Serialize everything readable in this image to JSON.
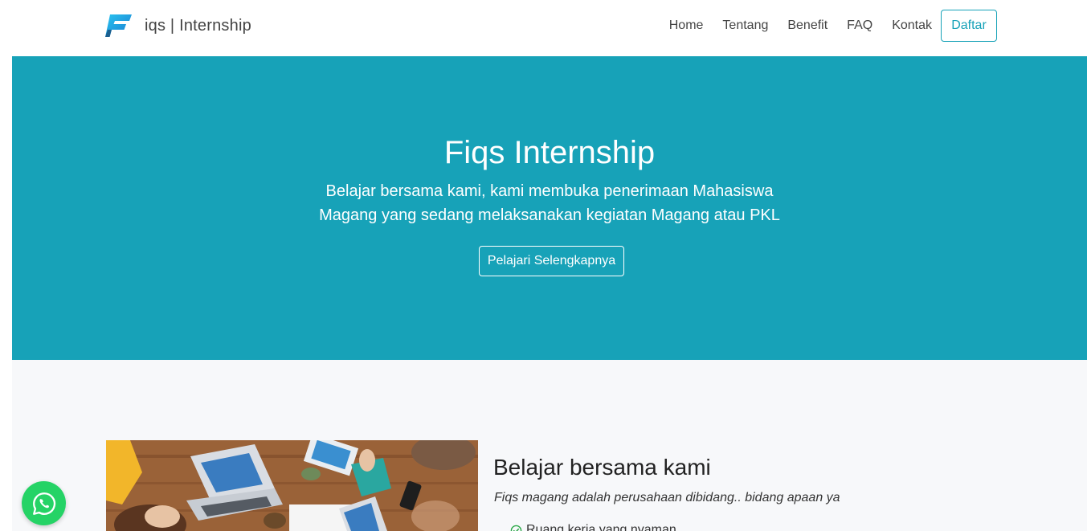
{
  "navbar": {
    "brand": "iqs | Internship",
    "links": [
      "Home",
      "Tentang",
      "Benefit",
      "FAQ",
      "Kontak"
    ],
    "cta": "Daftar"
  },
  "hero": {
    "title": "Fiqs Internship",
    "subtitle_line1": "Belajar bersama kami, kami membuka penerimaan Mahasiswa",
    "subtitle_line2": "Magang yang sedang melaksanakan kegiatan Magang atau PKL",
    "button": "Pelajari Selengkapnya"
  },
  "about": {
    "title": "Belajar bersama kami",
    "description": "Fiqs magang adalah perusahaan dibidang.. bidang apaan ya",
    "items": [
      "Ruang kerja yang nyaman"
    ]
  },
  "colors": {
    "accent": "#17a2b8",
    "section_bg": "#f7f8fa",
    "whatsapp": "#25d366"
  },
  "icons": {
    "logo": "fiqs-logo-icon",
    "check": "check-circle-icon",
    "whatsapp": "whatsapp-icon"
  }
}
